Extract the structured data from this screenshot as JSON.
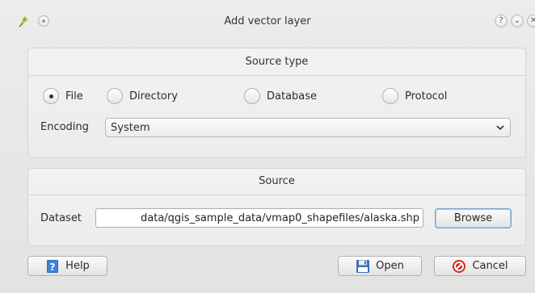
{
  "window": {
    "title": "Add vector layer",
    "help_glyph": "?",
    "shade_glyph": "⌄",
    "close_glyph": "✕"
  },
  "source_type": {
    "title": "Source type",
    "options": [
      {
        "label": "File",
        "checked": true
      },
      {
        "label": "Directory",
        "checked": false
      },
      {
        "label": "Database",
        "checked": false
      },
      {
        "label": "Protocol",
        "checked": false
      }
    ],
    "encoding_label": "Encoding",
    "encoding_value": "System"
  },
  "source": {
    "title": "Source",
    "dataset_label": "Dataset",
    "dataset_value": "data/qgis_sample_data/vmap0_shapefiles/alaska.shp",
    "browse_label": "Browse"
  },
  "buttons": {
    "help": "Help",
    "open": "Open",
    "cancel": "Cancel"
  },
  "icons": {
    "app": "qgis-icon",
    "help": "help-book-icon",
    "open": "floppy-disk-icon",
    "cancel": "no-entry-icon"
  },
  "colors": {
    "accent": "#7aa3d0",
    "cancel_red": "#d42c1e",
    "help_blue": "#2a6fbf"
  }
}
